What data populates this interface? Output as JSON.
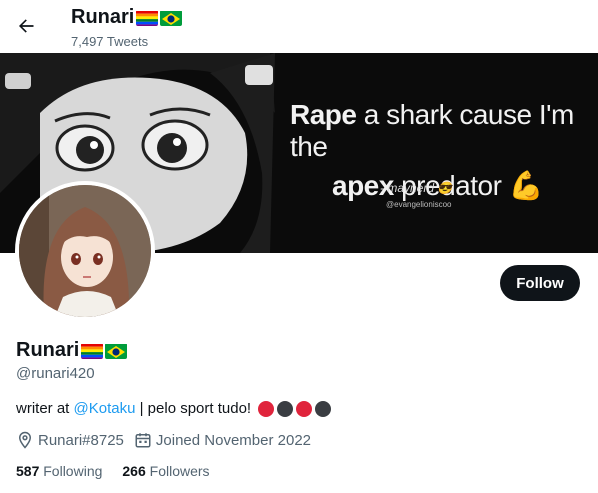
{
  "header": {
    "display_name": "Runari",
    "tweet_count": "7,497 Tweets",
    "back_icon": "arrow-left-icon"
  },
  "banner": {
    "line1_bold": "Rape",
    "line1_rest": " a shark cause I'm the",
    "line2_bold": "apex",
    "line2_rest": " predator",
    "line2_emoji": "💪",
    "credit": "- maynerd 😎",
    "credit_handle": "@evangelioniscoo"
  },
  "profile": {
    "display_name": "Runari",
    "handle": "@runari420",
    "bio_prefix": "writer at ",
    "bio_mention": "@Kotaku",
    "bio_suffix": " | pelo sport tudo!",
    "location": "Runari#8725",
    "joined": "Joined November 2022",
    "follow_label": "Follow"
  },
  "stats": {
    "following_count": "587",
    "following_label": " Following",
    "followers_count": "266",
    "followers_label": " Followers"
  },
  "colors": {
    "accent": "#1d9bf0",
    "text": "#0f1419",
    "secondary": "#536471",
    "dot_red": "#e0243c",
    "dot_dark": "#3a3d42"
  }
}
